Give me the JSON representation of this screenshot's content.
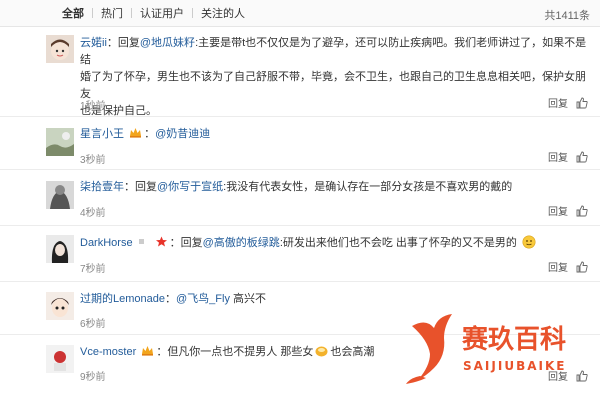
{
  "tabs": [
    "全部",
    "热门",
    "认证用户",
    "关注的人"
  ],
  "total": "共1411条",
  "comments": [
    {
      "name": "云婼ii",
      "reply_prefix": "回复",
      "reply_to": "@地瓜妹籽",
      "text_line1": ":主要是带t也不仅仅是为了避孕，还可以防止疾病吧。我们老师讲过了，如果不是结",
      "text_line2": "婚了为了怀孕，男生也不该为了自己舒服不带，毕竟，会不卫生，也跟自己的卫生息息相关吧，保护女朋友",
      "text_line3": "也是保护自己。",
      "time": "1秒前",
      "reply_label": "回复"
    },
    {
      "name": "星言小王",
      "mention": "@奶昔迪迪",
      "time": "3秒前",
      "reply_label": "回复"
    },
    {
      "name": "柒拾壹年",
      "reply_prefix": "回复",
      "reply_to": "@你写于宣纸",
      "text": ":我没有代表女性，是确认存在一部分女孩是不喜欢男的戴的",
      "time": "4秒前",
      "reply_label": "回复"
    },
    {
      "name": "DarkHorse",
      "reply_prefix": "回复",
      "reply_to": "@高傲的板绿跳",
      "text": ":研发出来他们也不会吃 出事了怀孕的又不是男的",
      "time": "7秒前",
      "reply_label": "回复"
    },
    {
      "name": "过期的Lemonade",
      "mention": "@飞鸟_Fly",
      "text": "高兴不",
      "time": "6秒前",
      "reply_label": "回复"
    },
    {
      "name": "Vce-moster",
      "text_a": "但凡你一点也不提男人 那些女",
      "text_b": "也会高潮",
      "time": "9秒前",
      "reply_label": "回复"
    }
  ],
  "watermark": {
    "title": "赛玖百科",
    "subtitle": "SAIJIUBAIKE",
    "color": "#e8522b"
  }
}
